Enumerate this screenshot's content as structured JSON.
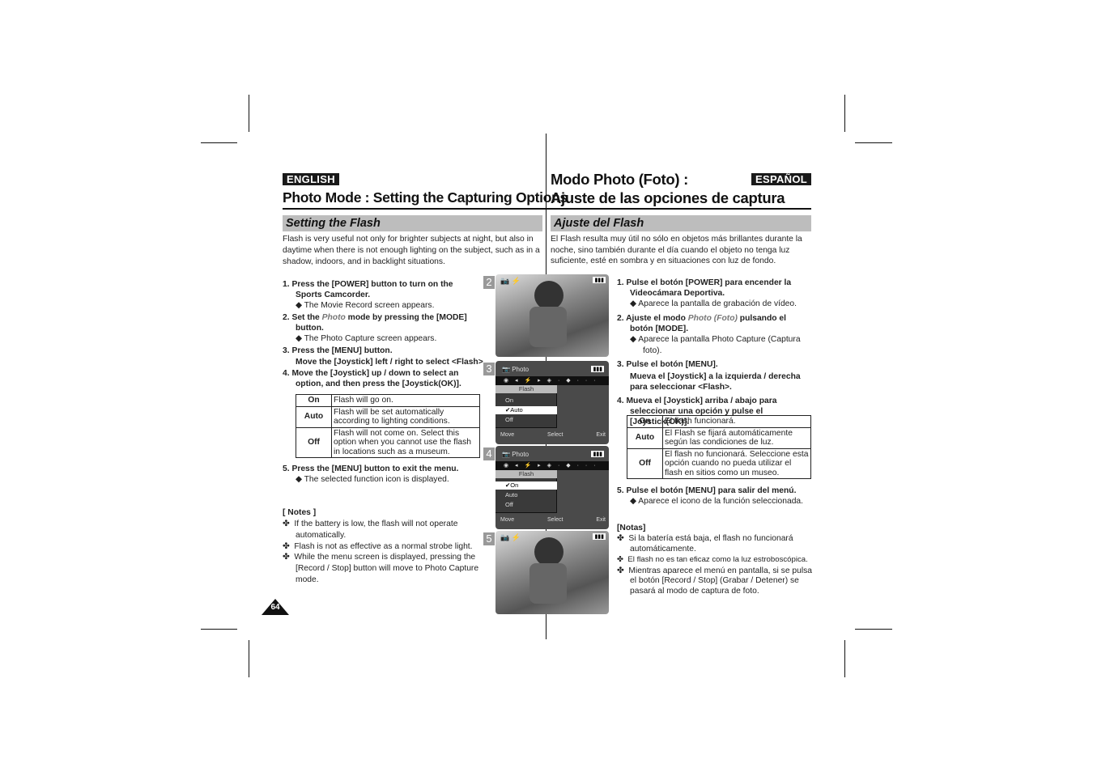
{
  "english": {
    "lang_badge": "ENGLISH",
    "title": "Photo Mode : Setting the Capturing Options",
    "section": "Setting the Flash",
    "intro": "Flash is very useful not only for brighter subjects at night, but also in daytime when there is not enough lighting on the subject, such as in a shadow, indoors, and in backlight situations.",
    "steps": [
      {
        "text": "1. Press the [POWER] button to turn on the Sports Camcorder.",
        "sub": "The Movie Record screen appears."
      },
      {
        "pre": "2. Set the ",
        "em": "Photo",
        "post": " mode by pressing the [MODE] button.",
        "sub": "The Photo Capture screen appears."
      },
      {
        "text": "3. Press the [MENU] button.",
        "text2": "Move the [Joystick] left / right to select <Flash>."
      },
      {
        "text": "4. Move the [Joystick] up / down to select an option, and then press the [Joystick(OK)]."
      },
      {
        "text": "5. Press the [MENU] button to exit the menu.",
        "sub": "The selected function icon is displayed."
      }
    ],
    "table": [
      {
        "k": "On",
        "v": "Flash will go on."
      },
      {
        "k": "Auto",
        "v": "Flash will be set automatically according to lighting conditions."
      },
      {
        "k": "Off",
        "v": "Flash will not come on. Select this option when you cannot use the flash in locations such as a museum."
      }
    ],
    "notes_title": "[ Notes ]",
    "notes": [
      "If the battery is low, the flash will not operate automatically.",
      "Flash is not as effective as a normal strobe light.",
      "While the menu screen is displayed, pressing the [Record / Stop] button will move to Photo Capture mode."
    ]
  },
  "espanol": {
    "title_line1": "Modo Photo (Foto) :",
    "lang_badge": "ESPAÑOL",
    "title_line2": "Ajuste de las opciones de captura",
    "section": "Ajuste del Flash",
    "intro": "El Flash resulta muy útil no sólo en objetos más brillantes durante la noche, sino también durante el día cuando el objeto no tenga luz suficiente, esté en sombra y en situaciones con luz de fondo.",
    "steps": [
      {
        "text": "1. Pulse el botón [POWER] para encender la Videocámara Deportiva.",
        "sub": "Aparece la pantalla de grabación de vídeo."
      },
      {
        "pre": "2. Ajuste el modo ",
        "em": "Photo (Foto)",
        "post": " pulsando el botón [MODE].",
        "sub": "Aparece la pantalla Photo Capture (Captura foto)."
      },
      {
        "text": "3. Pulse el botón [MENU].",
        "text2": "Mueva el [Joystick] a la izquierda / derecha para seleccionar <Flash>."
      },
      {
        "text": "4. Mueva el [Joystick] arriba / abajo para seleccionar una opción y pulse el [Joystick(OK)]."
      },
      {
        "text": "5. Pulse el botón [MENU] para salir del menú.",
        "sub": "Aparece el icono de la función seleccionada."
      }
    ],
    "table": [
      {
        "k": "On",
        "v": "El flash funcionará."
      },
      {
        "k": "Auto",
        "v": "El Flash se fijará automáticamente según las condiciones de luz."
      },
      {
        "k": "Off",
        "v": "El flash no funcionará. Seleccione esta opción cuando no pueda utilizar el flash en sitios como un museo."
      }
    ],
    "notes_title": "[Notas]",
    "notes": [
      "Si la batería está baja, el flash no funcionará automáticamente.",
      "El flash no es tan eficaz como la luz estroboscópica.",
      "Mientras aparece el menú en pantalla, si se pulsa el botón [Record / Stop] (Grabar / Detener) se pasará al modo de captura de foto."
    ]
  },
  "figures": {
    "numbers": [
      "2",
      "3",
      "4",
      "5"
    ],
    "menu": {
      "header": "Photo",
      "label": "Flash",
      "options": [
        "On",
        "Auto",
        "Off"
      ],
      "footer": [
        "Move",
        "Select",
        "Exit"
      ],
      "selected_fig3": "Auto",
      "selected_fig4": "On",
      "check": "✔"
    }
  },
  "page_number": "64",
  "bullet": "◆",
  "note_bullet": "✤"
}
